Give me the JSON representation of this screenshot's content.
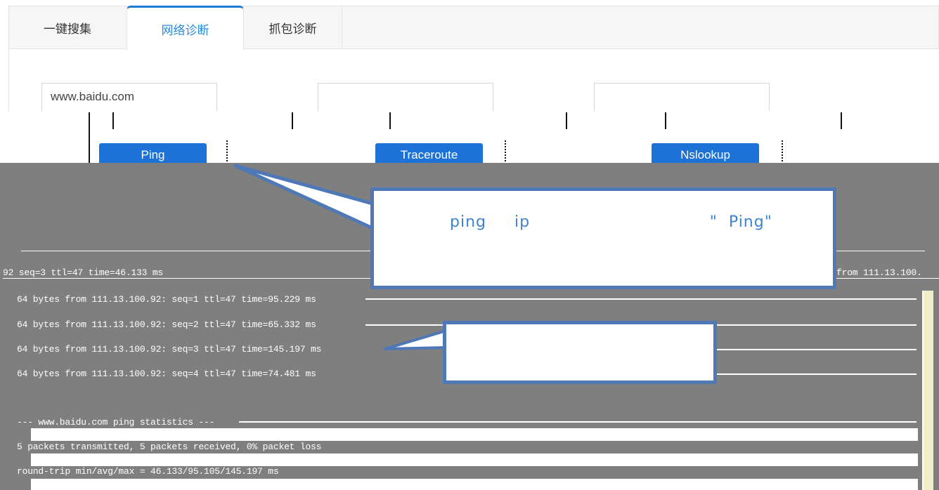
{
  "tabs": [
    {
      "label": "一键搜集",
      "active": false
    },
    {
      "label": "网络诊断",
      "active": true
    },
    {
      "label": "抓包诊断",
      "active": false
    }
  ],
  "inputs": {
    "ping_value": "www.baidu.com",
    "traceroute_value": "",
    "nslookup_value": ""
  },
  "buttons": {
    "ping": "Ping",
    "traceroute": "Traceroute",
    "nslookup": "Nslookup"
  },
  "callouts": {
    "main_text": "ping     ip                                \"  Ping\"",
    "secondary_text": ""
  },
  "terminal": {
    "header_left": "92 seq=3 ttl=47 time=46.133 ms",
    "header_right": "from 111.13.100.",
    "lines": [
      "64 bytes from 111.13.100.92: seq=1 ttl=47 time=95.229 ms",
      "64 bytes from 111.13.100.92: seq=2 ttl=47 time=65.332 ms",
      "64 bytes from 111.13.100.92: seq=3 ttl=47 time=145.197 ms",
      "64 bytes from 111.13.100.92: seq=4 ttl=47 time=74.481 ms"
    ],
    "stats_header": "--- www.baidu.com ping statistics ---",
    "stats_line1": "5 packets transmitted, 5 packets received, 0% packet loss",
    "stats_line2": "round-trip min/avg/max = 46.133/95.105/145.197 ms"
  },
  "colors": {
    "accent": "#1d72d8",
    "active_tab_text": "#2a8adc",
    "callout_border": "#4e78b6",
    "callout_text": "#3f83d0",
    "overlay_gray": "#7f7f7f"
  }
}
